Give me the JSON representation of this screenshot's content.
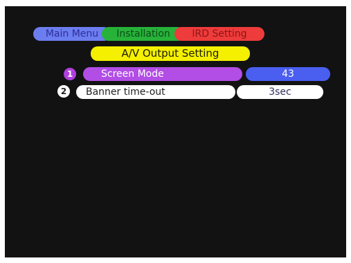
{
  "breadcrumb": {
    "main_menu": "Main Menu",
    "installation": "Installation",
    "ird_setting": "IRD Setting"
  },
  "page_title": "A/V Output Setting",
  "menu_items": [
    {
      "number": "1",
      "label": "Screen Mode",
      "value": "43"
    },
    {
      "number": "2",
      "label": "Banner time-out",
      "value": "3sec"
    }
  ],
  "colors": {
    "breadcrumb_main": "#6c7df0",
    "breadcrumb_installation": "#27b23a",
    "breadcrumb_ird": "#ee3b3b",
    "title": "#f4f000",
    "selected_item": "#b24de5",
    "selected_value": "#4a5ef0",
    "normal_item": "#ffffff",
    "background": "#121212"
  }
}
